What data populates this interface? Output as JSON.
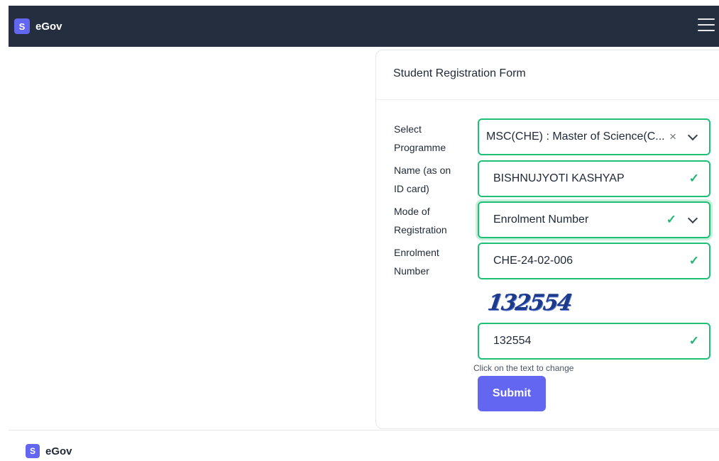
{
  "navbar": {
    "logo_letter": "S",
    "brand": "eGov",
    "menu_icon": "hamburger-menu-icon"
  },
  "form": {
    "title": "Student Registration Form",
    "programme": {
      "label": "Select Programme",
      "value": "MSC(CHE) : Master of Science(C...",
      "clear_icon": "×"
    },
    "name": {
      "label": "Name (as on ID card)",
      "value": "BISHNUJYOTI KASHYAP"
    },
    "mode": {
      "label": "Mode of Registration",
      "value": "Enrolment Number"
    },
    "enrolment": {
      "label": "Enrolment Number",
      "value": "CHE-24-02-006"
    },
    "captcha": {
      "image_text": "132554",
      "value": "132554",
      "hint": "Click on the text to change"
    },
    "check_mark": "✓",
    "submit_label": "Submit"
  },
  "footer": {
    "logo_letter": "S",
    "brand": "eGov"
  },
  "colors": {
    "navbar_bg": "#252e3f",
    "accent": "#6366f1",
    "valid_border": "#1fbf75",
    "check": "#22b573"
  }
}
